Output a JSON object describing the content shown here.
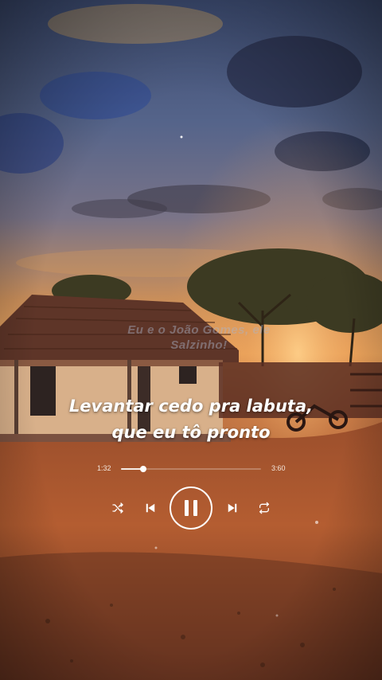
{
  "lyrics": {
    "line1": "Levantar cedo pra labuta,",
    "line2": "que eu tô pronto"
  },
  "watermark": {
    "line1": "Eu e o João Gomes, ele",
    "line2": "Salzinho!"
  },
  "player": {
    "current_time": "1:32",
    "total_time": "3:60",
    "progress": 0.16,
    "state": "playing",
    "icons": [
      "shuffle-icon",
      "previous-icon",
      "pause-icon",
      "next-icon",
      "repeat-icon"
    ]
  },
  "colors": {
    "accent": "#ffffff",
    "sky": "#4a5a7e",
    "sunset": "#e8a25a",
    "ground": "#a4532e"
  }
}
